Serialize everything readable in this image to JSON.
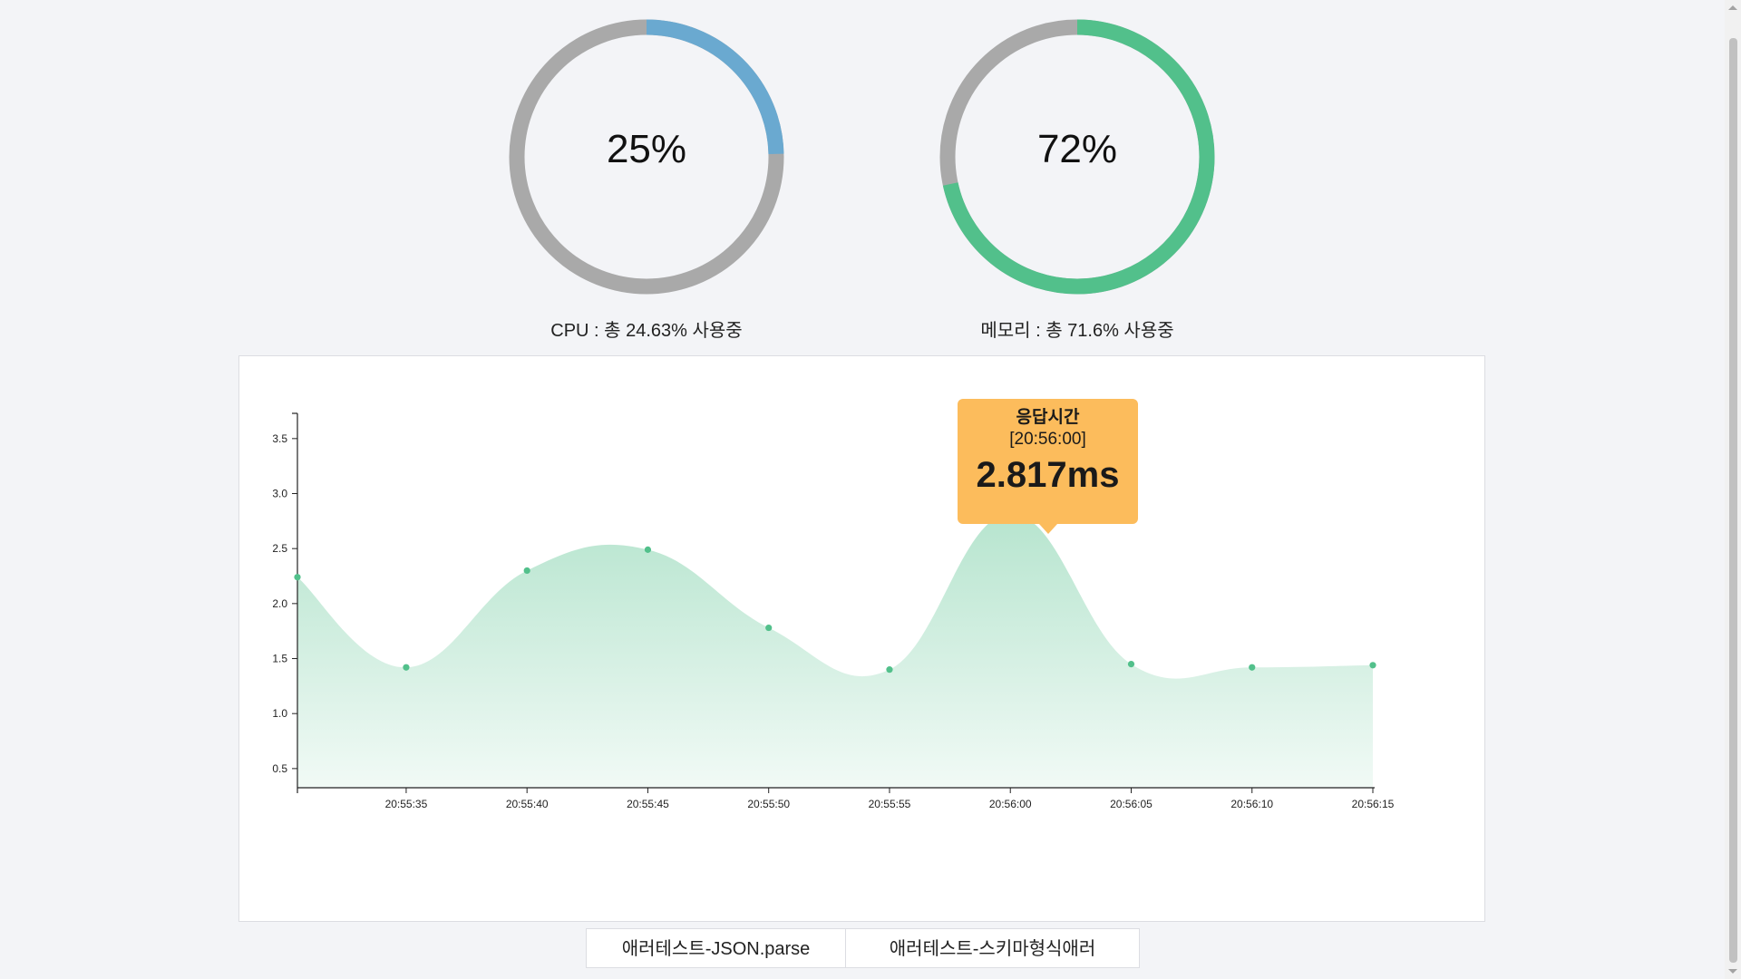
{
  "gauges": [
    {
      "id": "cpu",
      "value_text": "25%",
      "fraction": 0.2463,
      "caption": "CPU : 총 24.63% 사용중",
      "color": "#6aa9d0",
      "track_color": "#a9a9a9"
    },
    {
      "id": "memory",
      "value_text": "72%",
      "fraction": 0.716,
      "caption": "메모리 : 총 71.6% 사용중",
      "color": "#52c08b",
      "track_color": "#a9a9a9"
    }
  ],
  "tooltip": {
    "title": "응답시간",
    "time": "[20:56:00]",
    "value": "2.817ms"
  },
  "tabs": [
    {
      "label": "애러테스트-JSON.parse"
    },
    {
      "label": "애러테스트-스키마형식애러"
    }
  ],
  "chart_data": {
    "type": "area",
    "x": [
      "20:55:30",
      "20:55:35",
      "20:55:40",
      "20:55:45",
      "20:55:50",
      "20:55:55",
      "20:56:00",
      "20:56:05",
      "20:56:10",
      "20:56:15"
    ],
    "values": [
      2.24,
      1.42,
      2.3,
      2.49,
      1.78,
      1.4,
      2.817,
      1.45,
      1.42,
      1.44
    ],
    "x_tick_labels": [
      "20:55:35",
      "20:55:40",
      "20:55:45",
      "20:55:50",
      "20:55:55",
      "20:56:00",
      "20:56:05",
      "20:56:10",
      "20:56:15"
    ],
    "y_ticks": [
      0.5,
      1.0,
      1.5,
      2.0,
      2.5,
      3.0,
      3.5
    ],
    "y_tick_labels": [
      "0.5",
      "1.0",
      "1.5",
      "2.0",
      "2.5",
      "3.0",
      "3.5"
    ],
    "ylim": [
      0.4,
      3.82
    ],
    "xlim": [
      "20:55:30.5",
      "20:56:15"
    ],
    "line_color": "#52c08b",
    "fill_color": "#52c08b",
    "grid": false,
    "highlighted_point": "20:56:00"
  }
}
